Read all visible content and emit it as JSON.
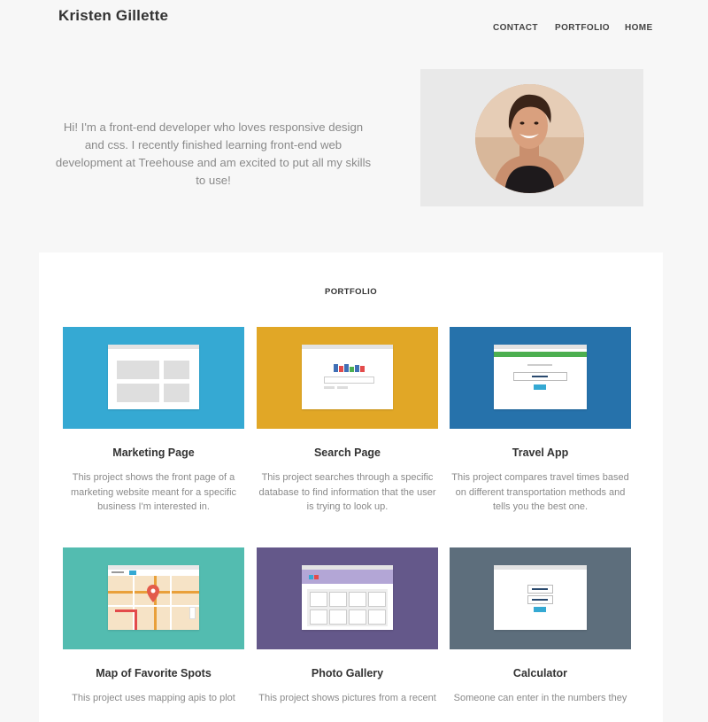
{
  "header": {
    "site_title": "Kristen Gillette",
    "nav": [
      "CONTACT",
      "PORTFOLIO",
      "HOME"
    ]
  },
  "intro": {
    "text": "Hi! I'm a front-end developer who loves responsive design and css. I recently finished learning front-end web development at Treehouse and am excited to put all my skills to use!"
  },
  "portfolio": {
    "heading": "PORTFOLIO",
    "projects": [
      {
        "title": "Marketing Page",
        "description": "This project shows the front page of a marketing website meant for a specific business I'm interested in.",
        "color": "#35a9d3"
      },
      {
        "title": "Search Page",
        "description": "This project searches through a specific database to find information that the user is trying to look up.",
        "color": "#e1a726"
      },
      {
        "title": "Travel App",
        "description": "This project compares travel times based on different transportation methods and tells you the best one.",
        "color": "#2672ab"
      },
      {
        "title": "Map of Favorite Spots",
        "description": "This project uses mapping apis to plot",
        "color": "#53bcb0"
      },
      {
        "title": "Photo Gallery",
        "description": "This project shows pictures from a recent",
        "color": "#64588a"
      },
      {
        "title": "Calculator",
        "description": "Someone can enter in the numbers they",
        "color": "#5d6e7c"
      }
    ]
  }
}
